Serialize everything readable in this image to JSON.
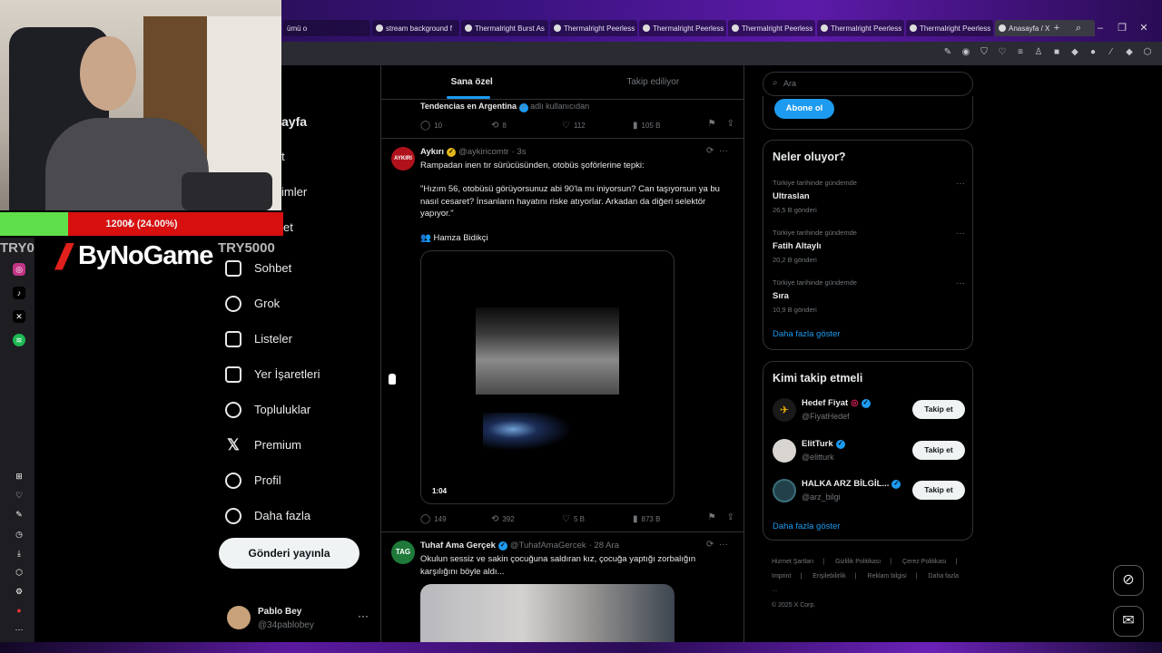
{
  "browser": {
    "tabs": [
      {
        "label": "ümü o"
      },
      {
        "label": "stream background f"
      },
      {
        "label": "Thermalright Burst As"
      },
      {
        "label": "Thermalright Peerless"
      },
      {
        "label": "Thermalright Peerless"
      },
      {
        "label": "Thermalright Peerless"
      },
      {
        "label": "Thermalright Peerless"
      },
      {
        "label": "Thermalright Peerless"
      },
      {
        "label": "Anasayfa / X"
      }
    ]
  },
  "overlay": {
    "progress_text": "1200₺ (24.00%)",
    "progress_value": 0.24,
    "try_left": "TRY0",
    "try_right": "TRY5000",
    "brand": "ByNoGame"
  },
  "nav": {
    "partial": [
      "ayfa",
      "t",
      "imler",
      "et"
    ],
    "items": [
      {
        "label": "Sohbet",
        "icon": "mail-icon"
      },
      {
        "label": "Grok",
        "icon": "grok-icon"
      },
      {
        "label": "Listeler",
        "icon": "list-icon"
      },
      {
        "label": "Yer İşaretleri",
        "icon": "bookmark-icon"
      },
      {
        "label": "Topluluklar",
        "icon": "communities-icon"
      },
      {
        "label": "Premium",
        "icon": "x-icon"
      },
      {
        "label": "Profil",
        "icon": "profile-icon"
      },
      {
        "label": "Daha fazla",
        "icon": "more-icon"
      }
    ],
    "post_button": "Gönderi yayınla",
    "profile": {
      "name": "Pablo Bey",
      "handle": "@34pablobey",
      "more": "···"
    }
  },
  "feed": {
    "tabs": [
      "Sana özel",
      "Takip ediliyor"
    ],
    "context": {
      "name": "Tendencias en Argentina",
      "suffix": "adlı kullanıcıdan"
    },
    "top_actions": {
      "replies": "10",
      "reposts": "8",
      "likes": "112",
      "views": "105 B"
    },
    "tweet1": {
      "name": "Aykırı",
      "handle": "@aykiricomtr",
      "time": "· 3s",
      "avatar_text": "AYKIRI",
      "text1": "Rampadan inen tır sürücüsünden, otobüs şoförlerine tepki:",
      "text2": "\"Hızım 56, otobüsü görüyorsunuz abi 90'la mı iniyorsun? Can taşıyorsun ya bu nasıl cesaret? İnsanların hayatını riske atıyorlar. Arkadan da diğeri selektör yapıyor.\"",
      "tag": "Hamza Bidikçi",
      "duration": "1:04",
      "replies": "149",
      "reposts": "392",
      "likes": "5 B",
      "views": "873 B"
    },
    "tweet2": {
      "name": "Tuhaf Ama Gerçek",
      "handle": "@TuhafAmaGercek",
      "time": "· 28 Ara",
      "avatar_text": "TAG",
      "text": "Okulun sessiz ve sakin çocuğuna saldıran kız, çocuğa yaptığı zorbalığın karşılığını böyle aldı..."
    }
  },
  "right": {
    "search_placeholder": "Ara",
    "subscribe": "Abone ol",
    "whats_happening": {
      "title": "Neler oluyor?",
      "trends": [
        {
          "context": "Türkiye tarihinde gündemde",
          "name": "Ultraslan",
          "count": "26,5 B gönderi"
        },
        {
          "context": "Türkiye tarihinde gündemde",
          "name": "Fatih Altaylı",
          "count": "20,2 B gönderi"
        },
        {
          "context": "Türkiye tarihinde gündemde",
          "name": "Sıra",
          "count": "10,9 B gönderi"
        }
      ],
      "show_more": "Daha fazla göster"
    },
    "who_to_follow": {
      "title": "Kimi takip etmeli",
      "accounts": [
        {
          "name": "Hedef Fiyat",
          "handle": "@FiyatHedef",
          "button": "Takip et"
        },
        {
          "name": "ElitTurk",
          "handle": "@elitturk",
          "button": "Takip et"
        },
        {
          "name": "HALKA ARZ BİLGİL...",
          "handle": "@arz_bilgi",
          "button": "Takip et"
        }
      ],
      "show_more": "Daha fazla göster"
    },
    "footer": {
      "links": [
        "Hizmet Şartları",
        "Gizlilik Politikası",
        "Çerez Politikası",
        "Imprint",
        "Erişilebilirlik",
        "Reklam bilgisi",
        "Daha fazla ···"
      ],
      "copyright": "© 2025 X Corp."
    }
  },
  "colors": {
    "accent": "#1d9bf0",
    "verified_gold": "#e2b719",
    "verified_blue": "#1d9bf0"
  }
}
